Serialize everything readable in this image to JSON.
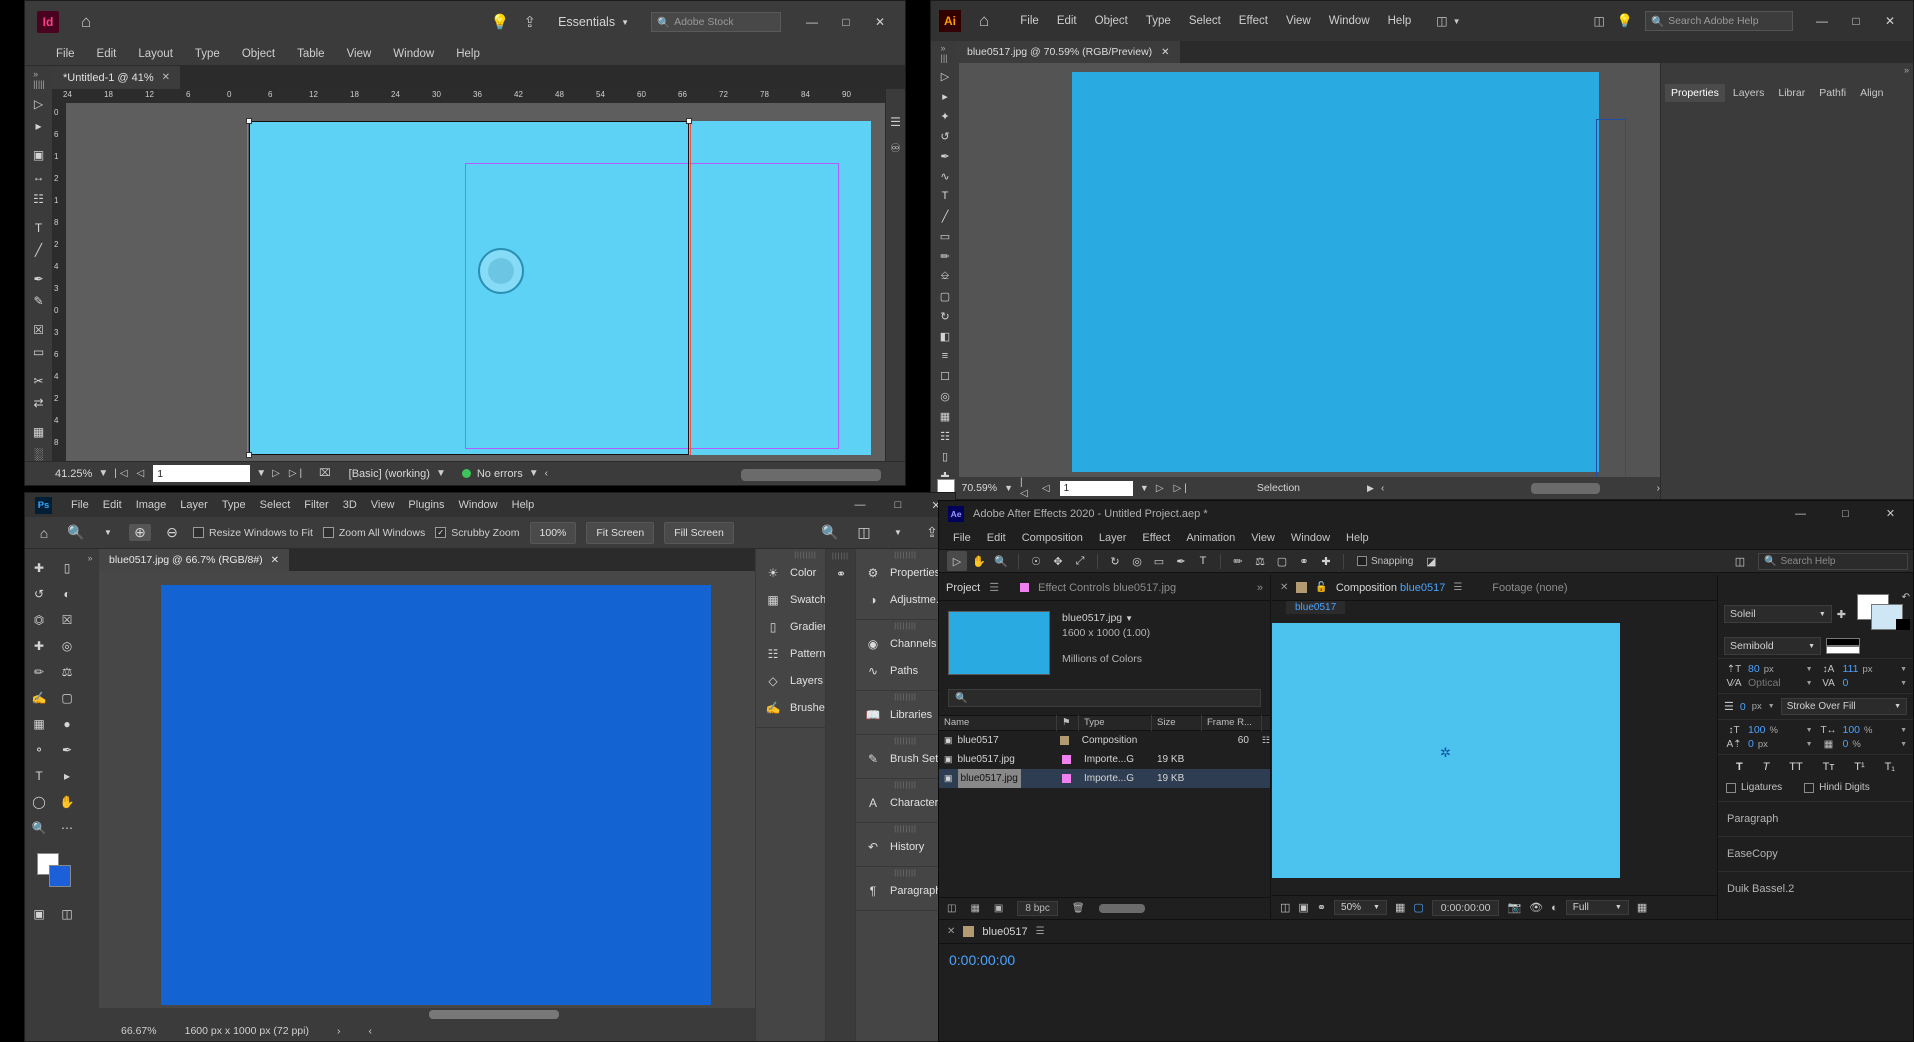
{
  "indesign": {
    "app_name": "Id",
    "menus": [
      "File",
      "Edit",
      "Layout",
      "Type",
      "Object",
      "Table",
      "View",
      "Window",
      "Help"
    ],
    "workspace": "Essentials",
    "stock_placeholder": "Adobe Stock",
    "tab_title": "*Untitled-1 @ 41%",
    "ruler_marks": [
      "24",
      "18",
      "12",
      "6",
      "0",
      "6",
      "12",
      "18",
      "24",
      "30",
      "36",
      "42",
      "48",
      "54",
      "60",
      "66",
      "72",
      "78",
      "84",
      "90"
    ],
    "ruler_v_marks": [
      "0",
      "6",
      "1",
      "2",
      "1",
      "8",
      "2",
      "4",
      "3",
      "0",
      "3",
      "6",
      "4",
      "2",
      "4",
      "8"
    ],
    "status": {
      "zoom": "41.25%",
      "page": "1",
      "preflight_profile": "[Basic] (working)",
      "errors": "No errors"
    },
    "tools": [
      "selection-tool",
      "direct-selection-tool",
      "page-tool",
      "gap-tool",
      "content-collector-tool",
      "type-tool",
      "line-tool",
      "pen-tool",
      "pencil-tool",
      "frame-tool",
      "rectangle-tool",
      "scissors-tool",
      "free-transform-tool",
      "gradient-swatch-tool",
      "gradient-feather-tool",
      "note-tool"
    ]
  },
  "illustrator": {
    "app_name": "Ai",
    "menus": [
      "File",
      "Edit",
      "Object",
      "Type",
      "Select",
      "Effect",
      "View",
      "Window",
      "Help"
    ],
    "search_placeholder": "Search Adobe Help",
    "tab_title": "blue0517.jpg @ 70.59% (RGB/Preview)",
    "panels": [
      "Properties",
      "Layers",
      "Librar",
      "Pathfi",
      "Align"
    ],
    "active_panel": "Properties",
    "status": {
      "zoom": "70.59%",
      "page": "1",
      "tool": "Selection"
    }
  },
  "photoshop": {
    "app_name": "Ps",
    "menus": [
      "File",
      "Edit",
      "Image",
      "Layer",
      "Type",
      "Select",
      "Filter",
      "3D",
      "View",
      "Plugins",
      "Window",
      "Help"
    ],
    "options": {
      "resize_windows": "Resize Windows to Fit",
      "zoom_all": "Zoom All Windows",
      "scrubby_zoom": "Scrubby Zoom",
      "scrubby_checked": true,
      "hundred": "100%",
      "fit_screen": "Fit Screen",
      "fill_screen": "Fill Screen"
    },
    "tab_title": "blue0517.jpg @ 66.7% (RGB/8#)",
    "status": {
      "zoom": "66.67%",
      "dimensions": "1600 px x 1000 px (72 ppi)"
    },
    "panel_group_1": [
      {
        "label": "Color",
        "icon": "color-wheel-icon"
      },
      {
        "label": "Swatches",
        "icon": "swatches-grid-icon"
      },
      {
        "label": "Gradients",
        "icon": "gradient-icon"
      },
      {
        "label": "Patterns",
        "icon": "patterns-icon"
      },
      {
        "label": "Layers",
        "icon": "layers-icon"
      },
      {
        "label": "Brushes",
        "icon": "brushes-icon"
      }
    ],
    "panel_group_2": [
      {
        "label": "Properties",
        "icon": "sliders-icon"
      },
      {
        "label": "Adjustme...",
        "icon": "half-circle-icon"
      },
      {
        "label": "Channels",
        "icon": "channels-icon"
      },
      {
        "label": "Paths",
        "icon": "paths-icon"
      },
      {
        "label": "Libraries",
        "icon": "libraries-icon"
      },
      {
        "label": "Brush Sett...",
        "icon": "brush-settings-icon"
      },
      {
        "label": "Character",
        "icon": "character-a-icon"
      },
      {
        "label": "History",
        "icon": "history-icon"
      },
      {
        "label": "Paragraph",
        "icon": "pilcrow-icon"
      }
    ]
  },
  "aftereffects": {
    "app_name": "Ae",
    "window_title": "Adobe After Effects 2020 - Untitled Project.aep *",
    "menus": [
      "File",
      "Edit",
      "Composition",
      "Layer",
      "Effect",
      "Animation",
      "View",
      "Window",
      "Help"
    ],
    "snapping_label": "Snapping",
    "search_placeholder": "Search Help",
    "project": {
      "tab_project": "Project",
      "tab_effect_controls": "Effect Controls blue0517.jpg",
      "item_name": "blue0517.jpg",
      "item_dims": "1600 x 1000 (1.00)",
      "item_colors": "Millions of Colors",
      "columns": [
        "Name",
        "Type",
        "Size",
        "Frame R..."
      ],
      "rows": [
        {
          "name": "blue0517",
          "type": "Composition",
          "size": "",
          "frame_rate": "60",
          "color": "#b29a73",
          "selected": false
        },
        {
          "name": "blue0517.jpg",
          "type": "Importe...G",
          "size": "19 KB",
          "frame_rate": "",
          "color": "#f080f0",
          "selected": false
        },
        {
          "name": "blue0517.jpg",
          "type": "Importe...G",
          "size": "19 KB",
          "frame_rate": "",
          "color": "#f080f0",
          "selected": true
        }
      ],
      "bpc": "8 bpc"
    },
    "composition": {
      "tab_label": "Composition",
      "comp_name": "blue0517",
      "footage_label": "Footage  (none)",
      "sub_tab": "blue0517",
      "zoom": "50%",
      "timecode": "0:00:00:00",
      "resolution": "Full"
    },
    "character": {
      "font_family": "Soleil",
      "font_style": "Semibold",
      "font_size": "80",
      "font_size_unit": "px",
      "leading": "111",
      "leading_unit": "px",
      "kerning": "Optical",
      "tracking": "0",
      "stroke_width": "0",
      "stroke_unit": "px",
      "stroke_order": "Stroke Over Fill",
      "vertical_scale": "100",
      "horizontal_scale": "100",
      "scale_unit": "%",
      "baseline_shift": "0",
      "baseline_unit": "px",
      "tsume": "0",
      "tsume_unit": "%",
      "styles": [
        "T",
        "T",
        "TT",
        "Tᴛ",
        "T¹",
        "T₁"
      ],
      "ligatures": "Ligatures",
      "hindi_digits": "Hindi Digits"
    },
    "accordions": [
      "Paragraph",
      "EaseCopy",
      "Duik Bassel.2"
    ],
    "timeline": {
      "comp_name": "blue0517",
      "timecode": "0:00:00:00"
    }
  }
}
